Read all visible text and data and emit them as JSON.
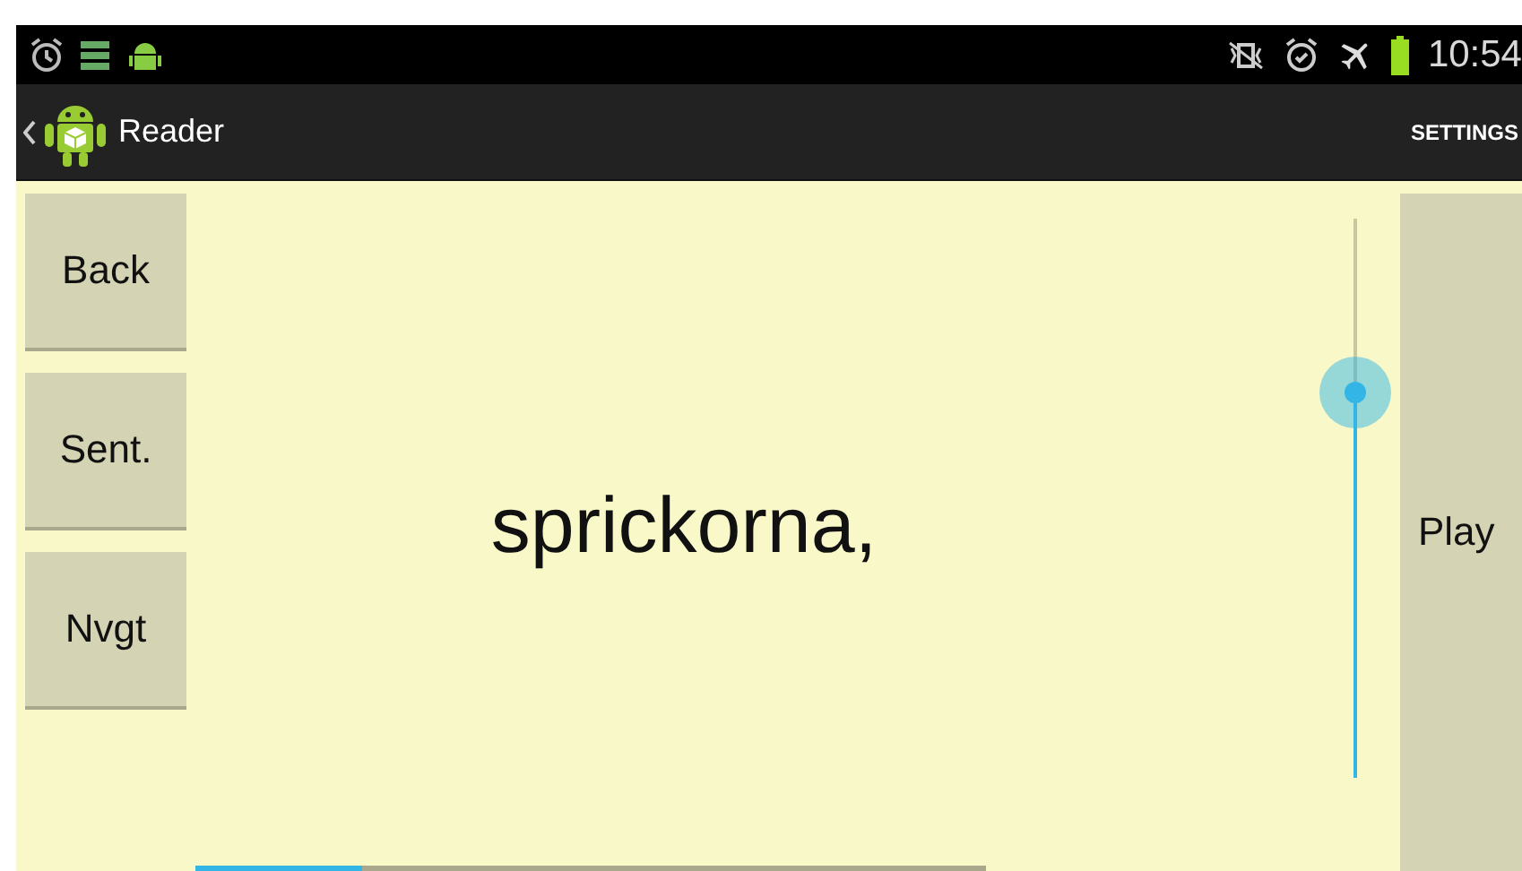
{
  "status_bar": {
    "time": "10:54"
  },
  "action_bar": {
    "title": "Reader",
    "action": "SETTINGS"
  },
  "nav_buttons": [
    {
      "label": "Back"
    },
    {
      "label": "Sent."
    },
    {
      "label": "Nvgt"
    }
  ],
  "word": "sprickorna,",
  "speed_slider": {
    "level": 0.69
  },
  "play_button": {
    "label": "Play"
  },
  "progress": {
    "level": 0.21
  }
}
